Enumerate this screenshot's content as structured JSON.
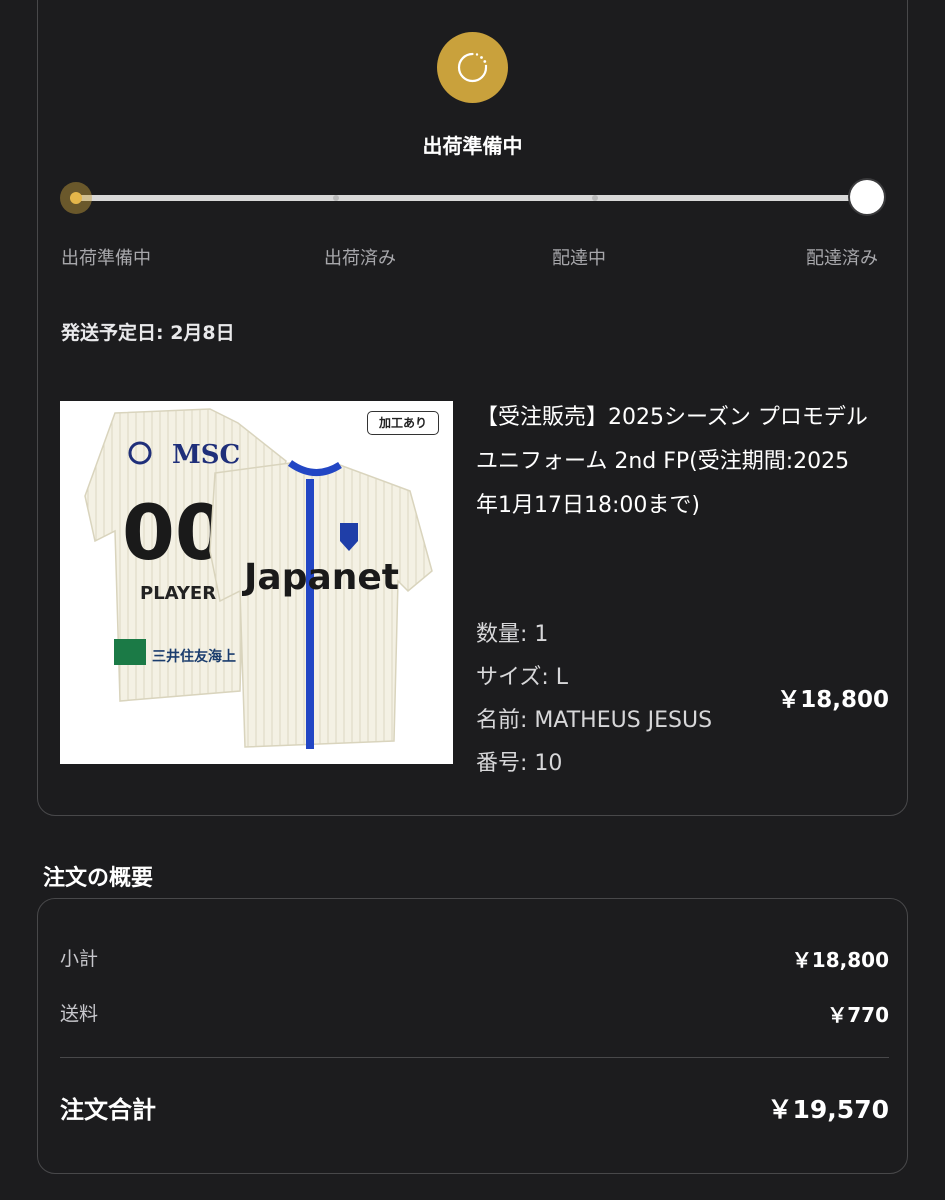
{
  "status": {
    "icon": "loading-icon",
    "title": "出荷準備中",
    "progress": 0,
    "stages": [
      "出荷準備中",
      "出荷済み",
      "配達中",
      "配達済み"
    ],
    "accent_color": "#c9a13c"
  },
  "shipping": {
    "estimated_date": "発送予定日: 2月8日"
  },
  "product": {
    "badge": "加工あり",
    "image_texts": [
      "MSC",
      "00",
      "PLAYER",
      "三井住友海上",
      "Japanet"
    ],
    "title": "【受注販売】2025シーズン プロモデルユニフォーム 2nd FP(受注期間:2025年1月17日18:00まで)",
    "specs": [
      "数量: 1",
      "サイズ: L",
      "名前: MATHEUS JESUS",
      "番号: 10"
    ],
    "price": "￥18,800"
  },
  "summary": {
    "heading": "注文の概要",
    "subtotal_label": "小計",
    "subtotal_value": "￥18,800",
    "shipping_label": "送料",
    "shipping_value": "￥770",
    "total_label": "注文合計",
    "total_value": "￥19,570"
  }
}
